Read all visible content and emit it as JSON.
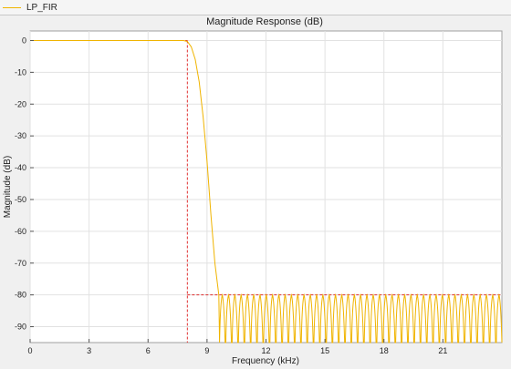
{
  "legend": {
    "series_name": "LP_FIR",
    "color": "#f0b400"
  },
  "chart_data": {
    "type": "line",
    "title": "Magnitude Response (dB)",
    "xlabel": "Frequency (kHz)",
    "ylabel": "Magnitude (dB)",
    "xlim": [
      0,
      24
    ],
    "ylim": [
      -95,
      3
    ],
    "xticks": [
      0,
      3,
      6,
      9,
      12,
      15,
      18,
      21
    ],
    "xtick_labels": [
      "0",
      "3",
      "6",
      "9",
      "12",
      "15",
      "18",
      "21"
    ],
    "yticks": [
      0,
      -10,
      -20,
      -30,
      -40,
      -50,
      -60,
      -70,
      -80,
      -90
    ],
    "ytick_labels": [
      "0",
      "-10",
      "-20",
      "-30",
      "-40",
      "-50",
      "-60",
      "-70",
      "-80",
      "-90"
    ],
    "grid": true,
    "series": [
      {
        "name": "LP_FIR",
        "color": "#f0b400",
        "passband_edge_khz": 8.0,
        "stopband_start_khz": 9.6,
        "stopband_level_db": -80,
        "x": [
          0,
          7.8,
          8.0,
          8.2,
          8.4,
          8.6,
          8.8,
          9.0,
          9.2,
          9.4,
          9.6
        ],
        "y": [
          0,
          0,
          -0.3,
          -2,
          -6,
          -13,
          -24,
          -38,
          -55,
          -70,
          -80
        ]
      },
      {
        "name": "spec-mask",
        "color": "#e03030",
        "style": "dashed",
        "segments": [
          {
            "x": [
              0,
              8.0
            ],
            "y": [
              0,
              0
            ]
          },
          {
            "x": [
              8.0,
              8.0
            ],
            "y": [
              0,
              -95
            ]
          },
          {
            "x": [
              8.0,
              24
            ],
            "y": [
              -80,
              -80
            ]
          }
        ]
      }
    ]
  }
}
